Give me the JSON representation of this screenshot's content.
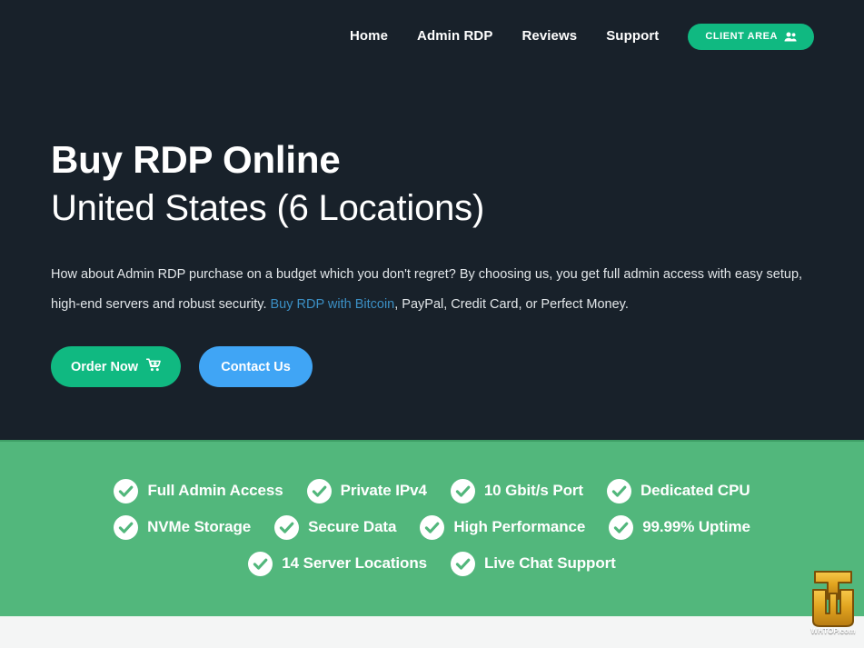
{
  "nav": {
    "links": [
      {
        "label": "Home"
      },
      {
        "label": "Admin RDP"
      },
      {
        "label": "Reviews"
      },
      {
        "label": "Support"
      }
    ],
    "client_area": {
      "label": "CLIENT AREA",
      "icon": "users-icon",
      "bg_color": "#10b981"
    }
  },
  "hero": {
    "headline_line1": "Buy RDP Online",
    "headline_line2": "United States (6 Locations)",
    "description_part1": "How about Admin RDP purchase on a budget which you don't regret? By choosing us, you get full admin access with easy setup, high-end servers and robust security. ",
    "description_link": "Buy RDP with Bitcoin",
    "description_part2": ", PayPal, Credit Card, or Perfect Money.",
    "link_color": "#3b8fc4",
    "background_color": "#18212a",
    "cta": {
      "order": {
        "label": "Order Now",
        "icon": "shopping-cart-icon",
        "bg_color": "#10b981"
      },
      "contact": {
        "label": "Contact Us",
        "bg_color": "#40a5f5"
      }
    }
  },
  "features": {
    "background_color": "#52b77c",
    "icon": "check-circle-icon",
    "items": [
      {
        "label": "Full Admin Access"
      },
      {
        "label": "Private IPv4"
      },
      {
        "label": "10 Gbit/s Port"
      },
      {
        "label": "Dedicated CPU"
      },
      {
        "label": "NVMe Storage"
      },
      {
        "label": "Secure Data"
      },
      {
        "label": "High Performance"
      },
      {
        "label": "99.99% Uptime"
      },
      {
        "label": "14 Server Locations"
      },
      {
        "label": "Live Chat Support"
      }
    ]
  },
  "watermark": {
    "caption": "WHTOP.com",
    "logo": "whtop-monogram-logo"
  }
}
